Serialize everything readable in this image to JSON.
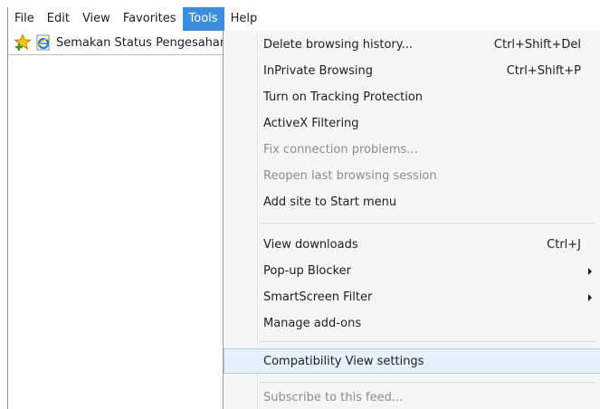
{
  "menubar": {
    "items": [
      {
        "label": "File"
      },
      {
        "label": "Edit"
      },
      {
        "label": "View"
      },
      {
        "label": "Favorites"
      },
      {
        "label": "Tools"
      },
      {
        "label": "Help"
      }
    ],
    "active": "Tools"
  },
  "favorites_bar": {
    "add_icon": "favorites-star-icon",
    "link_icon": "ie-page-icon",
    "link_label": "Semakan Status Pengesahan"
  },
  "tools_menu": {
    "items": [
      {
        "label": "Delete browsing history...",
        "shortcut": "Ctrl+Shift+Del",
        "enabled": true
      },
      {
        "label": "InPrivate Browsing",
        "shortcut": "Ctrl+Shift+P",
        "enabled": true
      },
      {
        "label": "Turn on Tracking Protection",
        "enabled": true
      },
      {
        "label": "ActiveX Filtering",
        "enabled": true
      },
      {
        "label": "Fix connection problems...",
        "enabled": false
      },
      {
        "label": "Reopen last browsing session",
        "enabled": false
      },
      {
        "label": "Add site to Start menu",
        "enabled": true
      },
      {
        "label": "View downloads",
        "shortcut": "Ctrl+J",
        "enabled": true
      },
      {
        "label": "Pop-up Blocker",
        "submenu": true,
        "enabled": true
      },
      {
        "label": "SmartScreen Filter",
        "submenu": true,
        "enabled": true
      },
      {
        "label": "Manage add-ons",
        "enabled": true
      },
      {
        "label": "Compatibility View settings",
        "enabled": true,
        "highlighted": true
      },
      {
        "label": "Subscribe to this feed...",
        "enabled": false
      }
    ]
  },
  "colors": {
    "menubar_active_bg": "#3d8ddb",
    "menu_bg": "#f5f5f5",
    "highlight_bg": "#e5f0fb",
    "highlight_border": "#a8cdef",
    "disabled_text": "#8d8d8d"
  }
}
